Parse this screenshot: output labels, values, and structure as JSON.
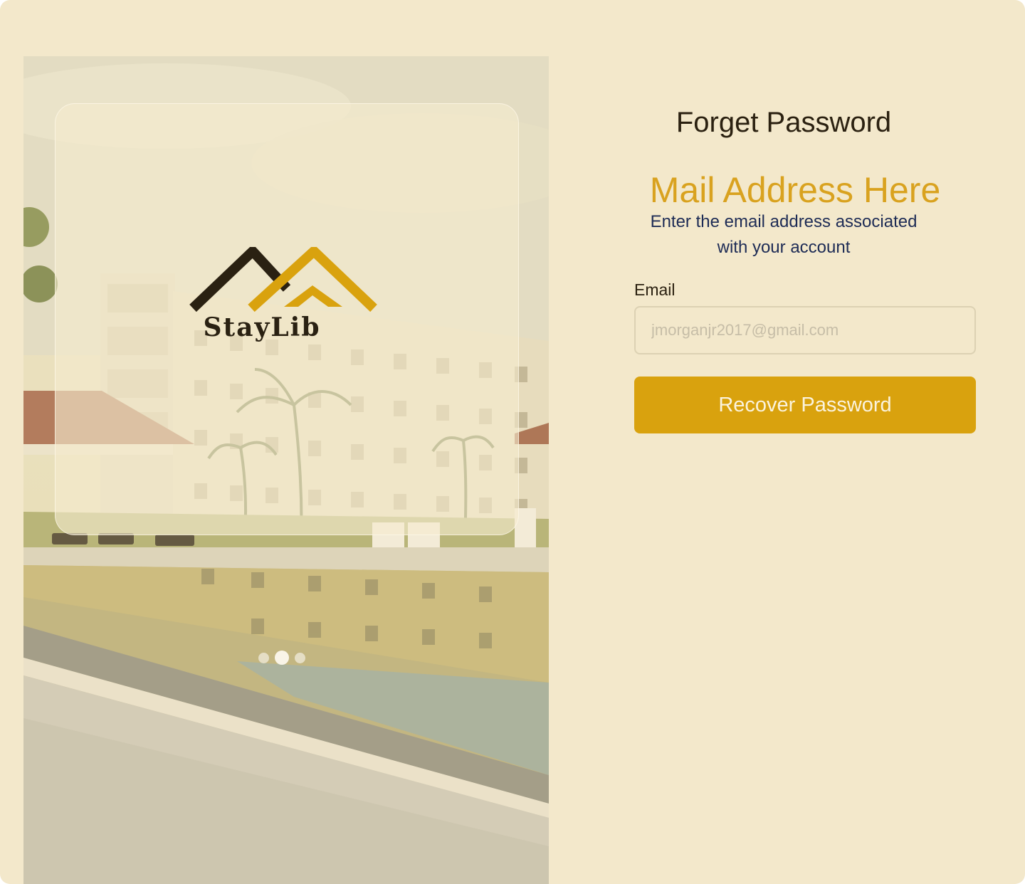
{
  "brand": {
    "name": "StayLib"
  },
  "carousel": {
    "slide_count": 3,
    "active_index": 1
  },
  "form": {
    "title": "Forget Password",
    "heading": "Mail Address Here",
    "description": "Enter the email address associated with your account",
    "email_label": "Email",
    "email_placeholder": "jmorganjr2017@gmail.com",
    "email_value": "",
    "submit_label": "Recover Password"
  },
  "colors": {
    "background": "#f3e8cb",
    "accent": "#d9a20e",
    "heading_gold": "#d9a21f",
    "description_navy": "#1d2b55",
    "text_dark": "#2b2111"
  },
  "icons": {
    "logo": "house-roofs-logo"
  }
}
